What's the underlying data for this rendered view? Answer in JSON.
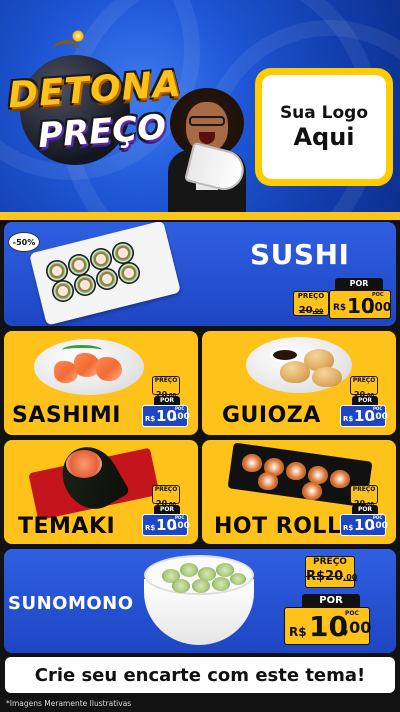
{
  "header": {
    "title_line1": "DETONA",
    "title_line2": "PREÇO",
    "logo_line1": "Sua Logo",
    "logo_line2": "Aqui"
  },
  "colors": {
    "brand_blue": "#1d46c4",
    "brand_yellow": "#ffc21a",
    "background_dark": "#121212"
  },
  "products": [
    {
      "name": "SUSHI",
      "discount_badge": "-50%",
      "preco_label": "PREÇO",
      "old_price": "20",
      "old_cents": ",00",
      "por_label": "POR",
      "currency": "R$",
      "price": "10",
      "cents": ",00",
      "cents_label": "POC"
    },
    {
      "name": "SASHIMI",
      "preco_label": "PREÇO",
      "old_price": "20",
      "old_cents": ",00",
      "por_label": "POR",
      "currency": "R$",
      "price": "10",
      "cents": ",00",
      "cents_label": "POC"
    },
    {
      "name": "GUIOZA",
      "preco_label": "PREÇO",
      "old_price": "20",
      "old_cents": ",00",
      "por_label": "POR",
      "currency": "R$",
      "price": "10",
      "cents": ",00",
      "cents_label": "POC"
    },
    {
      "name": "TEMAKI",
      "preco_label": "PREÇO",
      "old_price": "20",
      "old_cents": ",00",
      "por_label": "POR",
      "currency": "R$",
      "price": "10",
      "cents": ",00",
      "cents_label": "POC"
    },
    {
      "name": "HOT ROLL",
      "preco_label": "PREÇO",
      "old_price": "20",
      "old_cents": ",00",
      "por_label": "POR",
      "currency": "R$",
      "price": "10",
      "cents": ",00",
      "cents_label": "POC"
    },
    {
      "name": "SUNOMONO",
      "preco_label": "PREÇO",
      "old_price": "R$20",
      "old_cents": ",00",
      "por_label": "POR",
      "currency": "R$",
      "price": "10",
      "cents": ",00",
      "cents_label": "POC"
    }
  ],
  "footer": {
    "cta": "Crie seu encarte com este tema!",
    "disclaimer": "*Imagens Meramente Ilustrativas"
  }
}
